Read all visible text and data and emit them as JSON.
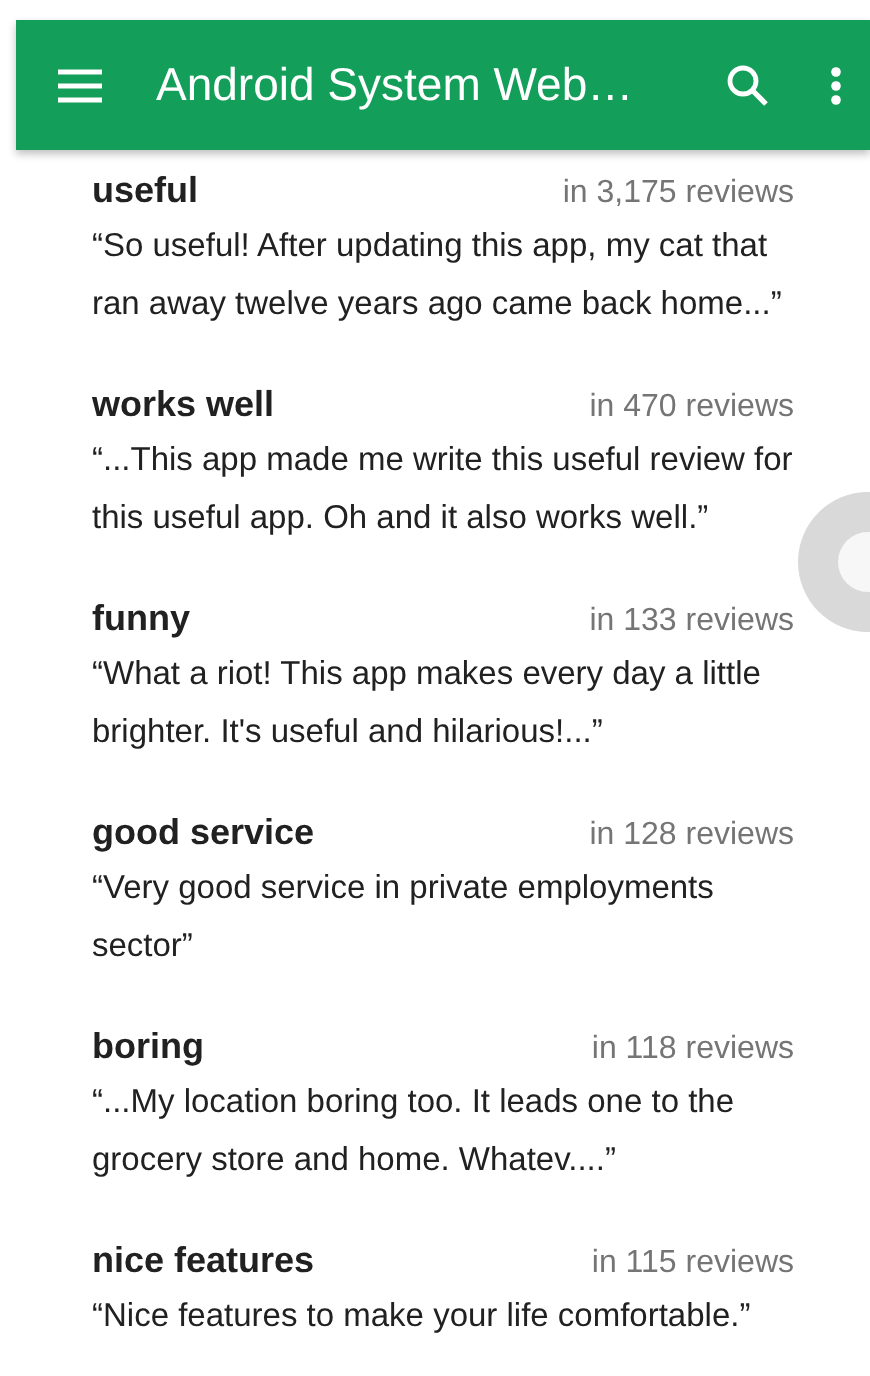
{
  "app_bar": {
    "title": "Android System Web…"
  },
  "review_topics": [
    {
      "topic": "useful",
      "count": "in 3,175 reviews",
      "quote": "“So useful! After updating this app, my cat that ran away twelve years ago came back home...”"
    },
    {
      "topic": "works well",
      "count": "in 470 reviews",
      "quote": "“...This app made me write this useful review for this useful app. Oh and it also works well.”"
    },
    {
      "topic": "funny",
      "count": "in 133 reviews",
      "quote": "“What a riot! This app makes every day a little brighter. It's useful and hilarious!...”"
    },
    {
      "topic": "good service",
      "count": "in 128 reviews",
      "quote": "“Very good service in private employments sector”"
    },
    {
      "topic": "boring",
      "count": "in 118 reviews",
      "quote": "“...My location boring too. It leads one to the grocery store and home. Whatev....”"
    },
    {
      "topic": "nice features",
      "count": "in 115 reviews",
      "quote": "“Nice features to make your life comfortable.”"
    }
  ]
}
